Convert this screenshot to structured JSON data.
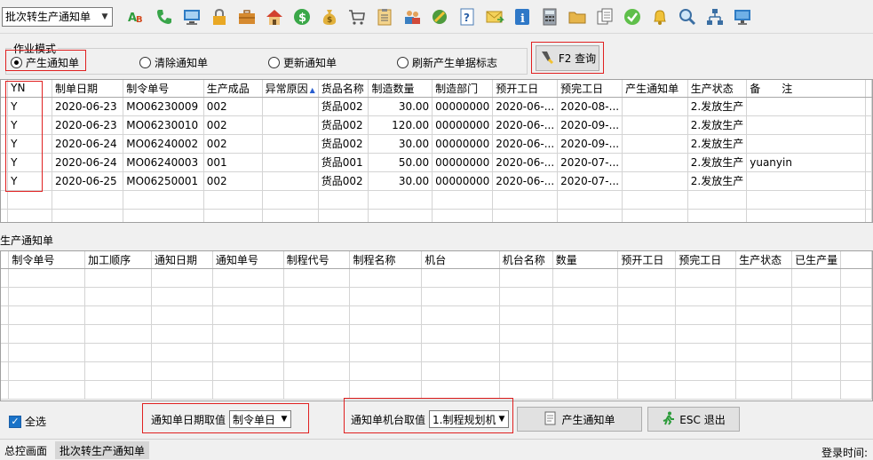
{
  "toolbar": {
    "combo_value": "批次转生产通知单",
    "icons": [
      "abc-icon",
      "phone-icon",
      "monitor-icon",
      "lock-icon",
      "briefcase-icon",
      "home-icon",
      "dollar-icon",
      "money-bag-icon",
      "cart-icon",
      "clipboard-icon",
      "users-icon",
      "link-icon",
      "help-icon",
      "mail-icon",
      "info-icon",
      "calculator-icon",
      "folder-icon",
      "copy-icon",
      "check-icon",
      "bell-icon",
      "search-icon",
      "org-chart-icon",
      "desktop-icon"
    ]
  },
  "mode": {
    "group_label": "作业模式",
    "options": [
      "产生通知单",
      "清除通知单",
      "更新通知单",
      "刷新产生单据标志"
    ],
    "query_button": "F2 查询"
  },
  "grid1": {
    "columns": [
      "YN",
      "制单日期",
      "制令单号",
      "生产成品",
      "异常原因",
      "货品名称",
      "制造数量",
      "制造部门",
      "预开工日",
      "预完工日",
      "产生通知单",
      "生产状态",
      "备　　注"
    ],
    "rows": [
      [
        "Y",
        "2020-06-23",
        "MO06230009",
        "002",
        "",
        "货品002",
        "30.00",
        "00000000",
        "2020-06-...",
        "2020-08-...",
        "",
        "2.发放生产",
        ""
      ],
      [
        "Y",
        "2020-06-23",
        "MO06230010",
        "002",
        "",
        "货品002",
        "120.00",
        "00000000",
        "2020-06-...",
        "2020-09-...",
        "",
        "2.发放生产",
        ""
      ],
      [
        "Y",
        "2020-06-24",
        "MO06240002",
        "002",
        "",
        "货品002",
        "30.00",
        "00000000",
        "2020-06-...",
        "2020-09-...",
        "",
        "2.发放生产",
        ""
      ],
      [
        "Y",
        "2020-06-24",
        "MO06240003",
        "001",
        "",
        "货品001",
        "50.00",
        "00000000",
        "2020-06-...",
        "2020-07-...",
        "",
        "2.发放生产",
        "yuanyin"
      ],
      [
        "Y",
        "2020-06-25",
        "MO06250001",
        "002",
        "",
        "货品002",
        "30.00",
        "00000000",
        "2020-06-...",
        "2020-07-...",
        "",
        "2.发放生产",
        ""
      ]
    ]
  },
  "grid2": {
    "title": "生产通知单",
    "columns": [
      "制令单号",
      "加工顺序",
      "通知日期",
      "通知单号",
      "制程代号",
      "制程名称",
      "机台",
      "机台名称",
      "数量",
      "预开工日",
      "预完工日",
      "生产状态",
      "已生产量"
    ]
  },
  "bottom": {
    "select_all": "全选",
    "date_label": "通知单日期取值",
    "date_value": "制令单日",
    "machine_label": "通知单机台取值",
    "machine_value": "1.制程规划机",
    "generate_button": "产生通知单",
    "exit_button": "ESC 退出"
  },
  "status": {
    "tabs": [
      "总控画面",
      "批次转生产通知单"
    ],
    "login": "登录时间:"
  },
  "colors": {
    "highlight_red": "#e02020",
    "checkbox_blue": "#1a73c8"
  }
}
